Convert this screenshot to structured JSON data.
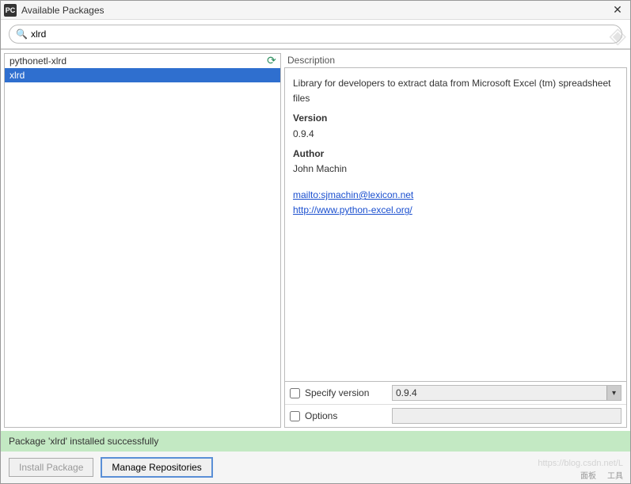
{
  "window": {
    "title": "Available Packages"
  },
  "search": {
    "value": "xlrd"
  },
  "packages": {
    "items": [
      {
        "name": "pythonetl-xlrd",
        "selected": false
      },
      {
        "name": "xlrd",
        "selected": true
      }
    ]
  },
  "description": {
    "label": "Description",
    "summary": "Library for developers to extract data from Microsoft Excel (tm) spreadsheet files",
    "version_label": "Version",
    "version": "0.9.4",
    "author_label": "Author",
    "author": "John Machin",
    "links": [
      "mailto:sjmachin@lexicon.net",
      "http://www.python-excel.org/"
    ]
  },
  "options": {
    "specify_version_label": "Specify version",
    "specify_version_value": "0.9.4",
    "options_label": "Options",
    "options_value": ""
  },
  "status": {
    "text": "Package 'xlrd' installed successfully"
  },
  "buttons": {
    "install": "Install Package",
    "manage": "Manage Repositories"
  },
  "footer": {
    "panel": "面板",
    "tools": "工具"
  },
  "watermark": "https://blog.csdn.net/L"
}
